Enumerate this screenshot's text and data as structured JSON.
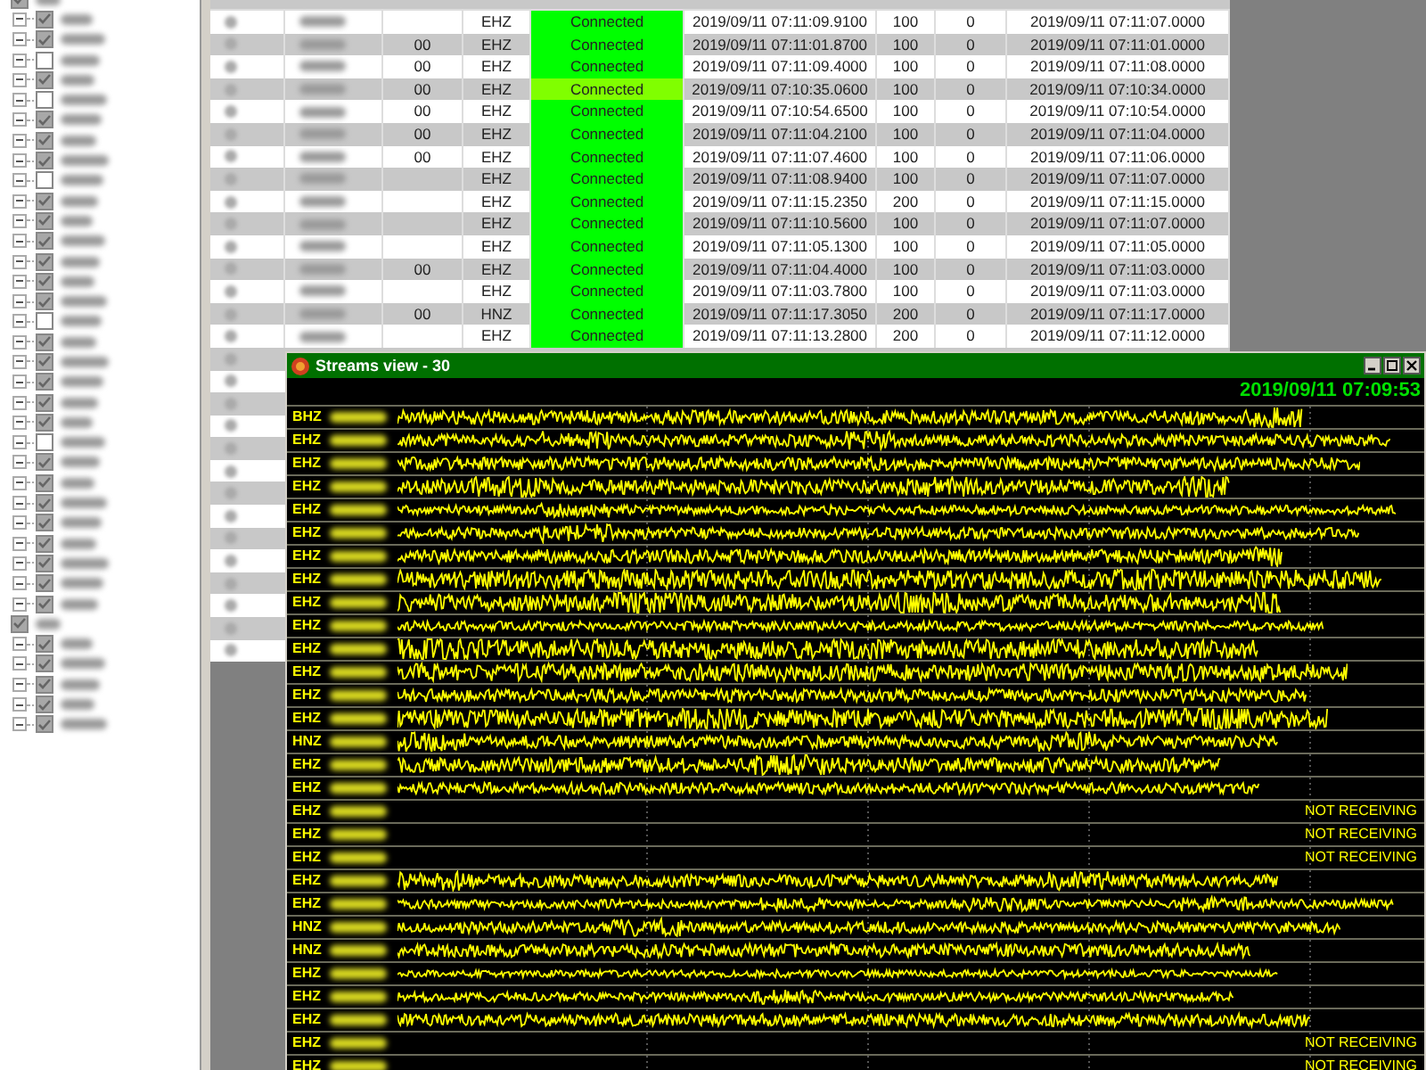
{
  "tree": [
    {
      "checked": true,
      "children": [
        {
          "checked": true
        },
        {
          "checked": true
        },
        {
          "checked": false
        },
        {
          "checked": true
        },
        {
          "checked": false
        },
        {
          "checked": true
        },
        {
          "checked": true
        },
        {
          "checked": true
        },
        {
          "checked": false
        },
        {
          "checked": true
        },
        {
          "checked": true
        },
        {
          "checked": true
        },
        {
          "checked": true
        },
        {
          "checked": true
        },
        {
          "checked": true
        },
        {
          "checked": false
        },
        {
          "checked": true
        },
        {
          "checked": true
        },
        {
          "checked": true
        },
        {
          "checked": true
        },
        {
          "checked": true
        },
        {
          "checked": false
        },
        {
          "checked": true
        },
        {
          "checked": true
        },
        {
          "checked": true
        },
        {
          "checked": true
        },
        {
          "checked": true
        },
        {
          "checked": true
        },
        {
          "checked": true
        },
        {
          "checked": true
        }
      ]
    },
    {
      "checked": true,
      "children": [
        {
          "checked": true
        },
        {
          "checked": true
        },
        {
          "checked": true
        },
        {
          "checked": true
        },
        {
          "checked": true
        }
      ]
    }
  ],
  "table": {
    "rows": [
      {
        "column_4": "EHZ",
        "column_5": "Connected",
        "color": "#00ff00",
        "column_6": "2019/09/11 07:11:09.9100",
        "column_7": "100",
        "column_8": "0",
        "column_9": "2019/09/11 07:11:07.0000"
      },
      {
        "column_3": "00",
        "column_4": "EHZ",
        "column_5": "Connected",
        "color": "#00ff00",
        "column_6": "2019/09/11 07:11:01.8700",
        "column_7": "100",
        "column_8": "0",
        "column_9": "2019/09/11 07:11:01.0000"
      },
      {
        "column_3": "00",
        "column_4": "EHZ",
        "column_5": "Connected",
        "color": "#00ff00",
        "column_6": "2019/09/11 07:11:09.4000",
        "column_7": "100",
        "column_8": "0",
        "column_9": "2019/09/11 07:11:08.0000"
      },
      {
        "column_3": "00",
        "column_4": "EHZ",
        "column_5": "Connected",
        "color": "#80ff00",
        "column_6": "2019/09/11 07:10:35.0600",
        "column_7": "100",
        "column_8": "0",
        "column_9": "2019/09/11 07:10:34.0000"
      },
      {
        "column_3": "00",
        "column_4": "EHZ",
        "column_5": "Connected",
        "color": "#00ff00",
        "column_6": "2019/09/11 07:10:54.6500",
        "column_7": "100",
        "column_8": "0",
        "column_9": "2019/09/11 07:10:54.0000"
      },
      {
        "column_3": "00",
        "column_4": "EHZ",
        "column_5": "Connected",
        "color": "#00ff00",
        "column_6": "2019/09/11 07:11:04.2100",
        "column_7": "100",
        "column_8": "0",
        "column_9": "2019/09/11 07:11:04.0000"
      },
      {
        "column_3": "00",
        "column_4": "EHZ",
        "column_5": "Connected",
        "color": "#00ff00",
        "column_6": "2019/09/11 07:11:07.4600",
        "column_7": "100",
        "column_8": "0",
        "column_9": "2019/09/11 07:11:06.0000"
      },
      {
        "column_4": "EHZ",
        "column_5": "Connected",
        "color": "#00ff00",
        "column_6": "2019/09/11 07:11:08.9400",
        "column_7": "100",
        "column_8": "0",
        "column_9": "2019/09/11 07:11:07.0000"
      },
      {
        "column_4": "EHZ",
        "column_5": "Connected",
        "color": "#00ff00",
        "column_6": "2019/09/11 07:11:15.2350",
        "column_7": "200",
        "column_8": "0",
        "column_9": "2019/09/11 07:11:15.0000"
      },
      {
        "column_4": "EHZ",
        "column_5": "Connected",
        "color": "#00ff00",
        "column_6": "2019/09/11 07:11:10.5600",
        "column_7": "100",
        "column_8": "0",
        "column_9": "2019/09/11 07:11:07.0000"
      },
      {
        "column_4": "EHZ",
        "column_5": "Connected",
        "color": "#00ff00",
        "column_6": "2019/09/11 07:11:05.1300",
        "column_7": "100",
        "column_8": "0",
        "column_9": "2019/09/11 07:11:05.0000"
      },
      {
        "column_3": "00",
        "column_4": "EHZ",
        "column_5": "Connected",
        "color": "#00ff00",
        "column_6": "2019/09/11 07:11:04.4000",
        "column_7": "100",
        "column_8": "0",
        "column_9": "2019/09/11 07:11:03.0000"
      },
      {
        "column_4": "EHZ",
        "column_5": "Connected",
        "color": "#00ff00",
        "column_6": "2019/09/11 07:11:03.7800",
        "column_7": "100",
        "column_8": "0",
        "column_9": "2019/09/11 07:11:03.0000"
      },
      {
        "column_3": "00",
        "column_4": "HNZ",
        "column_5": "Connected",
        "color": "#00ff00",
        "column_6": "2019/09/11 07:11:17.3050",
        "column_7": "200",
        "column_8": "0",
        "column_9": "2019/09/11 07:11:17.0000"
      },
      {
        "column_4": "EHZ",
        "column_5": "Connected",
        "color": "#00ff00",
        "column_6": "2019/09/11 07:11:13.2800",
        "column_7": "200",
        "column_8": "0",
        "column_9": "2019/09/11 07:11:12.0000"
      }
    ]
  },
  "streams_window": {
    "title": "Streams view - 30",
    "timestamp": "2019/09/11 07:09:53",
    "channels": [
      {
        "code": "BHZ",
        "kind": "trace"
      },
      {
        "code": "EHZ",
        "kind": "trace"
      },
      {
        "code": "EHZ",
        "kind": "trace"
      },
      {
        "code": "EHZ",
        "kind": "trace"
      },
      {
        "code": "EHZ",
        "kind": "trace"
      },
      {
        "code": "EHZ",
        "kind": "trace"
      },
      {
        "code": "EHZ",
        "kind": "trace"
      },
      {
        "code": "EHZ",
        "kind": "trace"
      },
      {
        "code": "EHZ",
        "kind": "trace"
      },
      {
        "code": "EHZ",
        "kind": "trace"
      },
      {
        "code": "EHZ",
        "kind": "trace"
      },
      {
        "code": "EHZ",
        "kind": "trace"
      },
      {
        "code": "EHZ",
        "kind": "trace"
      },
      {
        "code": "EHZ",
        "kind": "trace"
      },
      {
        "code": "HNZ",
        "kind": "trace"
      },
      {
        "code": "EHZ",
        "kind": "trace"
      },
      {
        "code": "EHZ",
        "kind": "trace"
      },
      {
        "code": "EHZ",
        "kind": "not_receiving",
        "status": "NOT RECEIVING"
      },
      {
        "code": "EHZ",
        "kind": "not_receiving",
        "status": "NOT RECEIVING"
      },
      {
        "code": "EHZ",
        "kind": "not_receiving",
        "status": "NOT RECEIVING"
      },
      {
        "code": "EHZ",
        "kind": "trace"
      },
      {
        "code": "EHZ",
        "kind": "trace"
      },
      {
        "code": "HNZ",
        "kind": "trace"
      },
      {
        "code": "HNZ",
        "kind": "trace"
      },
      {
        "code": "EHZ",
        "kind": "trace"
      },
      {
        "code": "EHZ",
        "kind": "trace"
      },
      {
        "code": "EHZ",
        "kind": "trace"
      },
      {
        "code": "EHZ",
        "kind": "not_receiving",
        "status": "NOT RECEIVING"
      },
      {
        "code": "EHZ",
        "kind": "not_receiving",
        "status": "NOT RECEIVING"
      }
    ]
  }
}
